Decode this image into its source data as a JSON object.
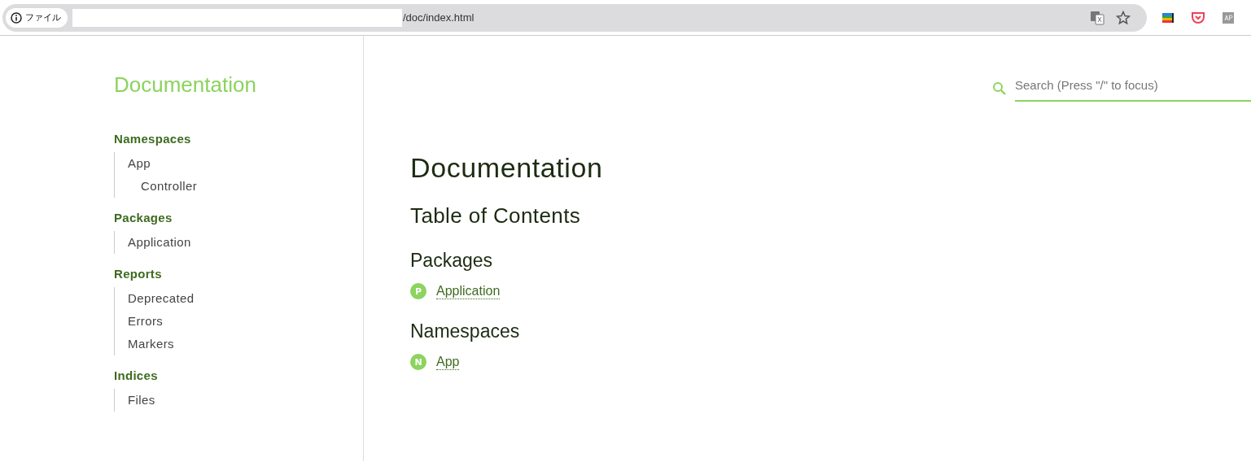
{
  "browser": {
    "scheme_label": "ファイル",
    "url": "/doc/index.html"
  },
  "sidebar": {
    "title": "Documentation",
    "sections": [
      {
        "heading": "Namespaces",
        "items": [
          {
            "label": "App",
            "children": [
              {
                "label": "Controller"
              }
            ]
          }
        ]
      },
      {
        "heading": "Packages",
        "items": [
          {
            "label": "Application"
          }
        ]
      },
      {
        "heading": "Reports",
        "items": [
          {
            "label": "Deprecated"
          },
          {
            "label": "Errors"
          },
          {
            "label": "Markers"
          }
        ]
      },
      {
        "heading": "Indices",
        "items": [
          {
            "label": "Files"
          }
        ]
      }
    ]
  },
  "search": {
    "placeholder": "Search (Press \"/\" to focus)"
  },
  "content": {
    "title": "Documentation",
    "subtitle": "Table of Contents",
    "groups": [
      {
        "heading": "Packages",
        "links": [
          {
            "badge": "P",
            "label": "Application"
          }
        ]
      },
      {
        "heading": "Namespaces",
        "links": [
          {
            "badge": "N",
            "label": "App"
          }
        ]
      }
    ]
  }
}
